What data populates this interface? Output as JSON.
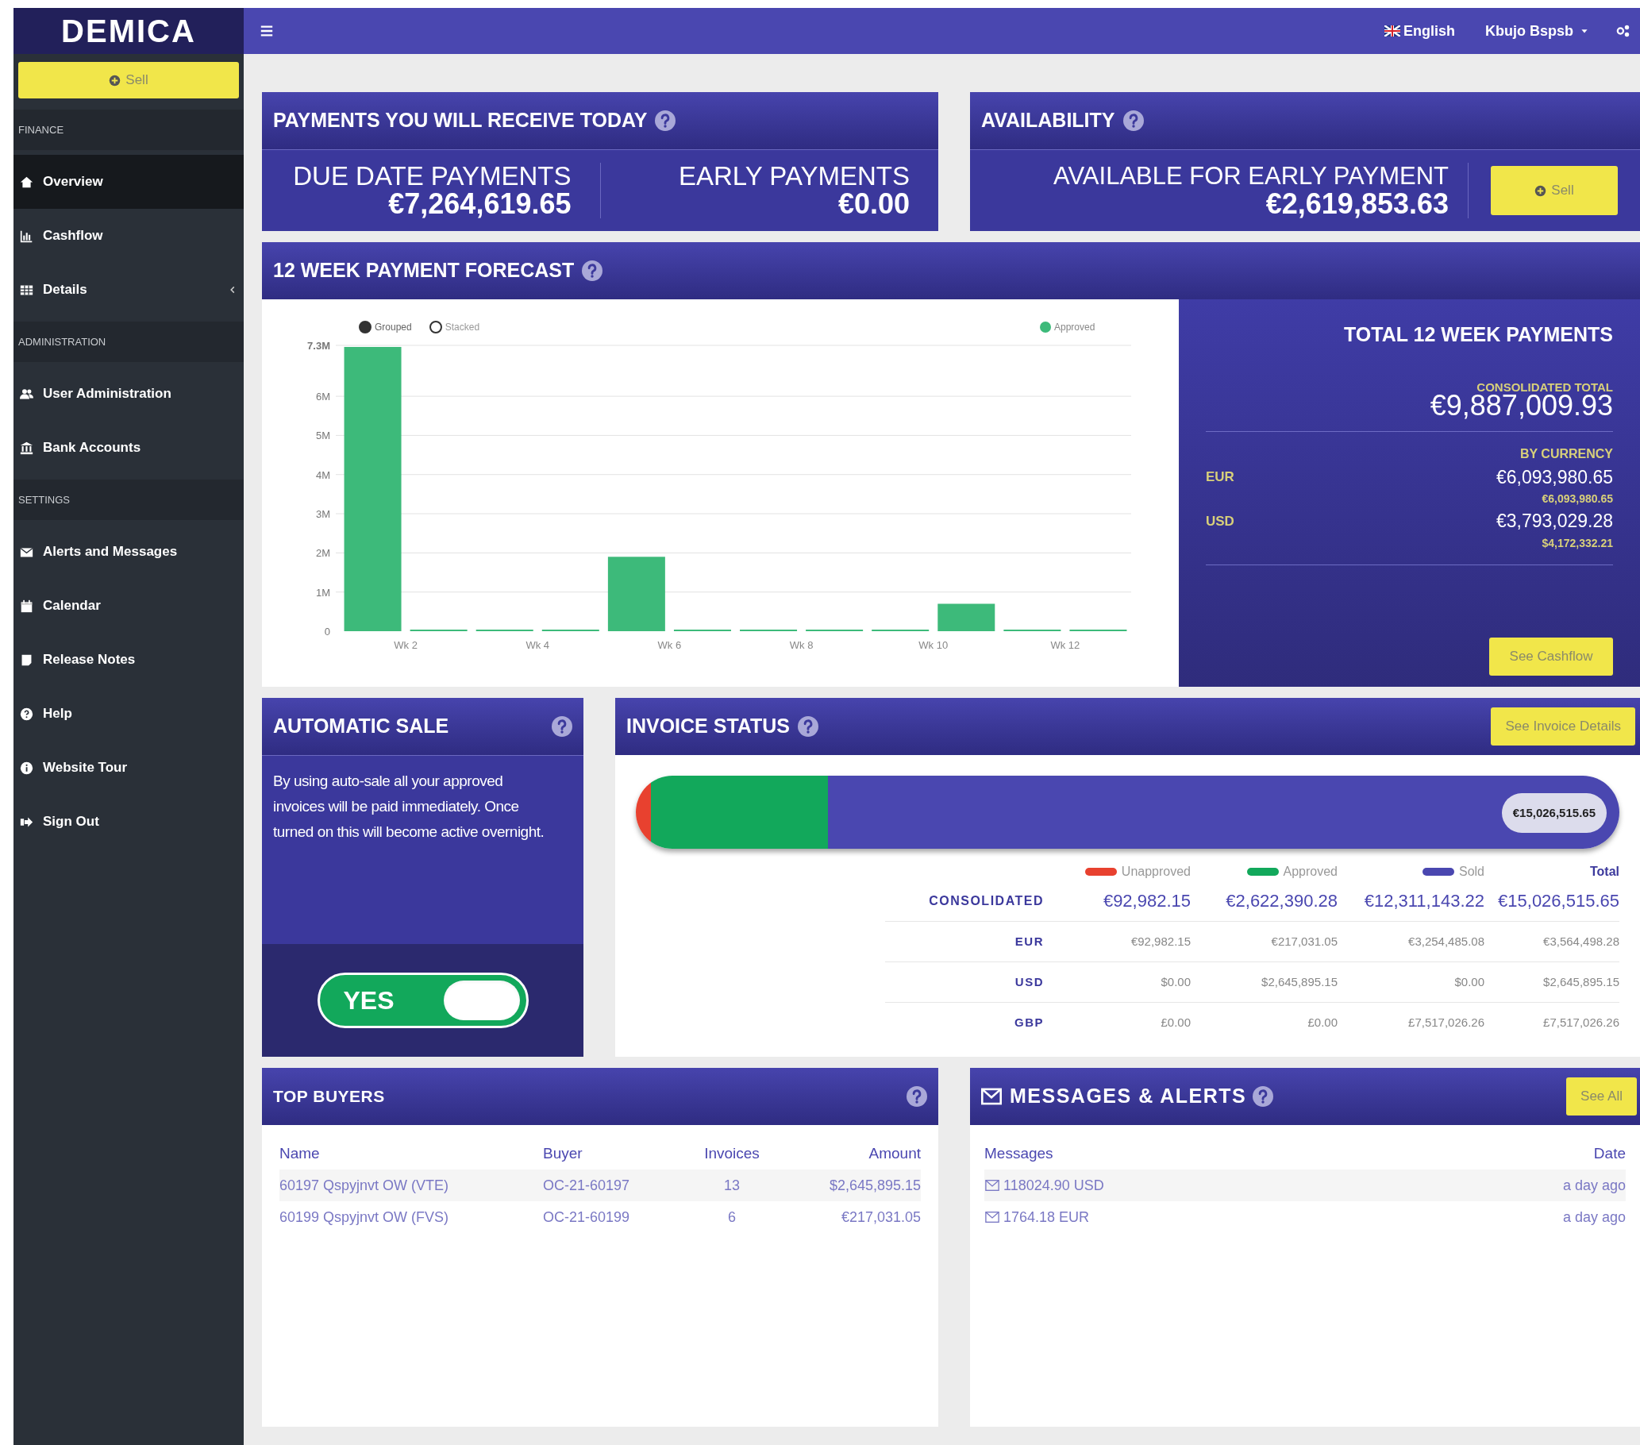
{
  "sidebar": {
    "logo": "DEMICA",
    "sell_button": "Sell",
    "sections": [
      {
        "heading": "FINANCE",
        "items": [
          {
            "label": "Overview",
            "selected": true,
            "expandable": false
          },
          {
            "label": "Cashflow",
            "selected": false,
            "expandable": false
          },
          {
            "label": "Details",
            "selected": false,
            "expandable": true
          }
        ]
      },
      {
        "heading": "ADMINISTRATION",
        "items": [
          {
            "label": "User Administration",
            "selected": false,
            "expandable": false
          },
          {
            "label": "Bank Accounts",
            "selected": false,
            "expandable": false
          }
        ]
      },
      {
        "heading": "SETTINGS",
        "items": [
          {
            "label": "Alerts and Messages",
            "selected": false,
            "expandable": false
          },
          {
            "label": "Calendar",
            "selected": false,
            "expandable": false
          },
          {
            "label": "Release Notes",
            "selected": false,
            "expandable": false
          },
          {
            "label": "Help",
            "selected": false,
            "expandable": false
          },
          {
            "label": "Website Tour",
            "selected": false,
            "expandable": false
          },
          {
            "label": "Sign Out",
            "selected": false,
            "expandable": false
          }
        ]
      }
    ]
  },
  "top_bar": {
    "language": "English",
    "user": "Kbujo Bspsb"
  },
  "payments_today": {
    "title": "PAYMENTS YOU WILL RECEIVE TODAY",
    "stats": [
      {
        "label": "DUE DATE PAYMENTS",
        "value": "€7,264,619.65"
      },
      {
        "label": "EARLY PAYMENTS",
        "value": "€0.00"
      }
    ]
  },
  "availability": {
    "title": "AVAILABILITY",
    "label": "AVAILABLE FOR EARLY PAYMENT",
    "value": "€2,619,853.63",
    "button": "Sell"
  },
  "forecast": {
    "title": "12 WEEK PAYMENT FORECAST",
    "modes": [
      {
        "label": "Grouped",
        "selected": true
      },
      {
        "label": "Stacked",
        "selected": false
      }
    ],
    "chart_data": {
      "type": "bar",
      "categories": [
        null,
        "Wk 2",
        null,
        "Wk 4",
        null,
        "Wk 6",
        null,
        "Wk 8",
        null,
        "Wk 10",
        null,
        "Wk 12"
      ],
      "series": [
        {
          "name": "Approved",
          "color": "#3dba7a",
          "values": [
            7.26,
            0.03,
            0.03,
            0.03,
            1.9,
            0.03,
            0.03,
            0.03,
            0.03,
            0.7,
            0.03,
            0.03
          ]
        }
      ],
      "ylim": [
        0,
        7.3
      ],
      "grid": true,
      "yticks": [
        {
          "value": 0,
          "label": "0"
        },
        {
          "value": 1,
          "label": "1M"
        },
        {
          "value": 2,
          "label": "2M"
        },
        {
          "value": 3,
          "label": "3M"
        },
        {
          "value": 4,
          "label": "4M"
        },
        {
          "value": 5,
          "label": "5M"
        },
        {
          "value": 6,
          "label": "6M"
        },
        {
          "value": 7.3,
          "label": "7.3M"
        }
      ]
    },
    "total": {
      "title": "TOTAL 12 WEEK PAYMENTS",
      "consolidated_label": "CONSOLIDATED TOTAL",
      "consolidated_value": "€9,887,009.93",
      "by_currency_label": "BY CURRENCY",
      "currencies": [
        {
          "code": "EUR",
          "value": "€6,093,980.65",
          "original": "€6,093,980.65"
        },
        {
          "code": "USD",
          "value": "€3,793,029.28",
          "original": "$4,172,332.21"
        }
      ],
      "button": "See Cashflow"
    }
  },
  "automatic_sale": {
    "title": "AUTOMATIC SALE",
    "description": "By using auto-sale all your approved invoices will be paid immediately. Once turned on this will become active overnight.",
    "toggle": {
      "label": "YES",
      "on": true
    }
  },
  "invoice_status": {
    "title": "INVOICE STATUS",
    "button": "See Invoice Details",
    "total_badge": "€15,026,515.65",
    "columns": [
      {
        "label": "Unapproved",
        "color": "#e8412f"
      },
      {
        "label": "Approved",
        "color": "#12a85b"
      },
      {
        "label": "Sold",
        "color": "#4a47b0"
      },
      {
        "label": "Total"
      }
    ],
    "rows": [
      {
        "kind": "consolidated",
        "label": "CONSOLIDATED",
        "cells": [
          "€92,982.15",
          "€2,622,390.28",
          "€12,311,143.22",
          "€15,026,515.65"
        ]
      },
      {
        "kind": "currency",
        "label": "EUR",
        "cells": [
          "€92,982.15",
          "€217,031.05",
          "€3,254,485.08",
          "€3,564,498.28"
        ]
      },
      {
        "kind": "currency",
        "label": "USD",
        "cells": [
          "$0.00",
          "$2,645,895.15",
          "$0.00",
          "$2,645,895.15"
        ]
      },
      {
        "kind": "currency",
        "label": "GBP",
        "cells": [
          "£0.00",
          "£0.00",
          "£7,517,026.26",
          "£7,517,026.26"
        ]
      }
    ]
  },
  "top_buyers": {
    "title": "TOP BUYERS",
    "columns": [
      "Name",
      "Buyer",
      "Invoices",
      "Amount"
    ],
    "rows": [
      [
        "60197 Qspyjnvt OW (VTE)",
        "OC-21-60197",
        "13",
        "$2,645,895.15"
      ],
      [
        "60199 Qspyjnvt OW (FVS)",
        "OC-21-60199",
        "6",
        "€217,031.05"
      ]
    ]
  },
  "messages": {
    "title": "MESSAGES & ALERTS",
    "button": "See All",
    "columns": [
      "Messages",
      "Date"
    ],
    "rows": [
      {
        "text": "118024.90 USD",
        "date": "a day ago"
      },
      {
        "text": "1764.18 EUR",
        "date": "a day ago"
      }
    ]
  }
}
